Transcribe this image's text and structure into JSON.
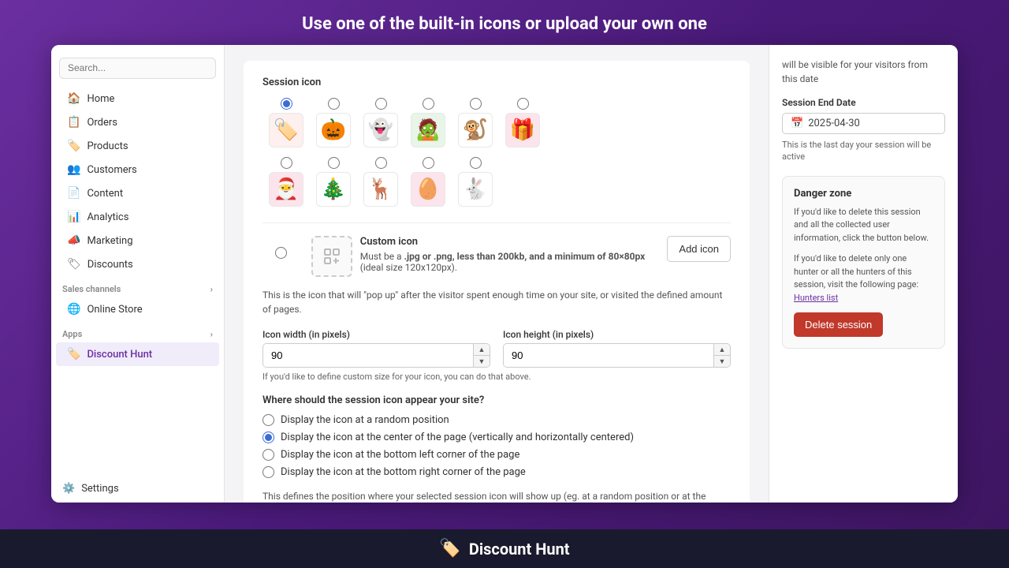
{
  "topTitle": "Use one of the built-in icons or upload your own one",
  "sidebar": {
    "items": [
      {
        "id": "home",
        "label": "Home",
        "icon": "🏠",
        "active": false
      },
      {
        "id": "orders",
        "label": "Orders",
        "icon": "📋",
        "active": false
      },
      {
        "id": "products",
        "label": "Products",
        "icon": "🏷️",
        "active": false
      },
      {
        "id": "customers",
        "label": "Customers",
        "icon": "👥",
        "active": false
      },
      {
        "id": "content",
        "label": "Content",
        "icon": "📄",
        "active": false
      },
      {
        "id": "analytics",
        "label": "Analytics",
        "icon": "📊",
        "active": false
      },
      {
        "id": "marketing",
        "label": "Marketing",
        "icon": "📣",
        "active": false
      },
      {
        "id": "discounts",
        "label": "Discounts",
        "icon": "🏷",
        "active": false
      }
    ],
    "salesChannels": {
      "label": "Sales channels",
      "items": [
        {
          "id": "online-store",
          "label": "Online Store",
          "icon": "🌐"
        }
      ]
    },
    "apps": {
      "label": "Apps",
      "items": [
        {
          "id": "discount-hunt",
          "label": "Discount Hunt",
          "icon": "🏷️",
          "active": true
        }
      ]
    },
    "settings": {
      "label": "Settings",
      "icon": "⚙️"
    }
  },
  "sessionIcon": {
    "label": "Session icon",
    "icons": [
      {
        "emoji": "🏷️",
        "selected": true
      },
      {
        "emoji": "🎃",
        "selected": false
      },
      {
        "emoji": "👻",
        "selected": false
      },
      {
        "emoji": "🧟",
        "selected": false
      },
      {
        "emoji": "🐒",
        "selected": false
      },
      {
        "emoji": "🎁",
        "selected": false
      },
      {
        "emoji": "🎅",
        "selected": false
      },
      {
        "emoji": "🎄",
        "selected": false
      },
      {
        "emoji": "🦌",
        "selected": false
      },
      {
        "emoji": "🥚",
        "selected": false
      },
      {
        "emoji": "🐇",
        "selected": false
      }
    ]
  },
  "customIcon": {
    "label": "Custom icon",
    "description": "Must be a .jpg or .png, less than 200kb, and a minimum of 80×80px",
    "descriptionItalic": "(ideal size 120x120px).",
    "buttonLabel": "Add icon"
  },
  "iconInfo": "This is the icon that will \"pop up\" after the visitor spent enough time on your site, or visited the defined amount of pages.",
  "iconWidth": {
    "label": "Icon width (in pixels)",
    "value": "90"
  },
  "iconHeight": {
    "label": "Icon height (in pixels)",
    "value": "90"
  },
  "customSizeNote": "If you'd like to define custom size for your icon, you can do that above.",
  "position": {
    "label": "Where should the session icon appear your site?",
    "options": [
      {
        "label": "Display the icon at a random position",
        "selected": false
      },
      {
        "label": "Display the icon at the center of the page (vertically and horizontally centered)",
        "selected": true
      },
      {
        "label": "Display the icon at the bottom left corner of the page",
        "selected": false
      },
      {
        "label": "Display the icon at the bottom right corner of the page",
        "selected": false
      }
    ],
    "note": "This defines the position where your selected session icon will show up (eg. at a random position or at the bottom left corner of your website, etc)"
  },
  "rightPanel": {
    "visibilityNote": "will be visible for your visitors from this date",
    "sessionEndDate": {
      "label": "Session End Date",
      "value": "2025-04-30",
      "note": "This is the last day your session will be active"
    },
    "dangerZone": {
      "title": "Danger zone",
      "text1": "If you'd like to delete this session and all the collected user information, click the button below.",
      "text2": "If you'd like to delete only one hunter or all the hunters of this session, visit the following page:",
      "linkText": "Hunters list",
      "deleteButton": "Delete session"
    }
  },
  "bottomBar": {
    "icon": "🏷️",
    "label": "Discount Hunt"
  }
}
